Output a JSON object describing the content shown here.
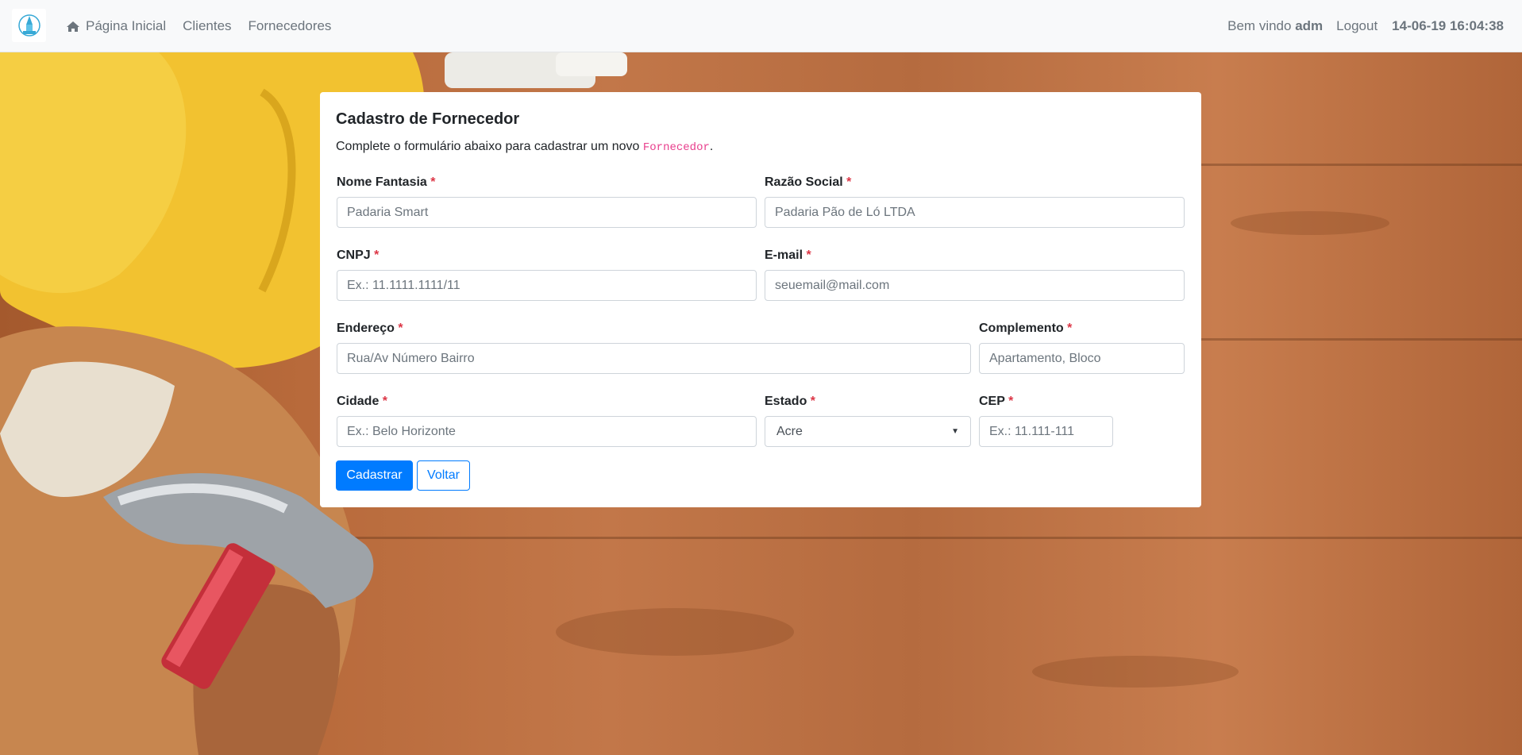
{
  "navbar": {
    "home_label": "Página Inicial",
    "clients_label": "Clientes",
    "suppliers_label": "Fornecedores",
    "welcome_prefix": "Bem vindo",
    "username": "adm",
    "logout_label": "Logout",
    "datetime": "14-06-19 16:04:38"
  },
  "form": {
    "title": "Cadastro de Fornecedor",
    "subtitle_prefix": "Complete o formulário abaixo para cadastrar um novo",
    "subtitle_code": "Fornecedor",
    "subtitle_suffix": ".",
    "required_mark": "*",
    "fields": {
      "nome_fantasia": {
        "label": "Nome Fantasia",
        "placeholder": "Padaria Smart"
      },
      "razao_social": {
        "label": "Razão Social",
        "placeholder": "Padaria Pão de Ló LTDA"
      },
      "cnpj": {
        "label": "CNPJ",
        "placeholder": "Ex.: 11.1111.1111/11"
      },
      "email": {
        "label": "E-mail",
        "placeholder": "seuemail@mail.com"
      },
      "endereco": {
        "label": "Endereço",
        "placeholder": "Rua/Av Número Bairro"
      },
      "complemento": {
        "label": "Complemento",
        "placeholder": "Apartamento, Bloco"
      },
      "cidade": {
        "label": "Cidade",
        "placeholder": "Ex.: Belo Horizonte"
      },
      "estado": {
        "label": "Estado",
        "selected": "Acre"
      },
      "cep": {
        "label": "CEP",
        "placeholder": "Ex.: 11.111-111"
      }
    },
    "submit_label": "Cadastrar",
    "back_label": "Voltar"
  },
  "colors": {
    "primary": "#007bff",
    "required": "#dc3545",
    "code": "#e83e8c"
  }
}
